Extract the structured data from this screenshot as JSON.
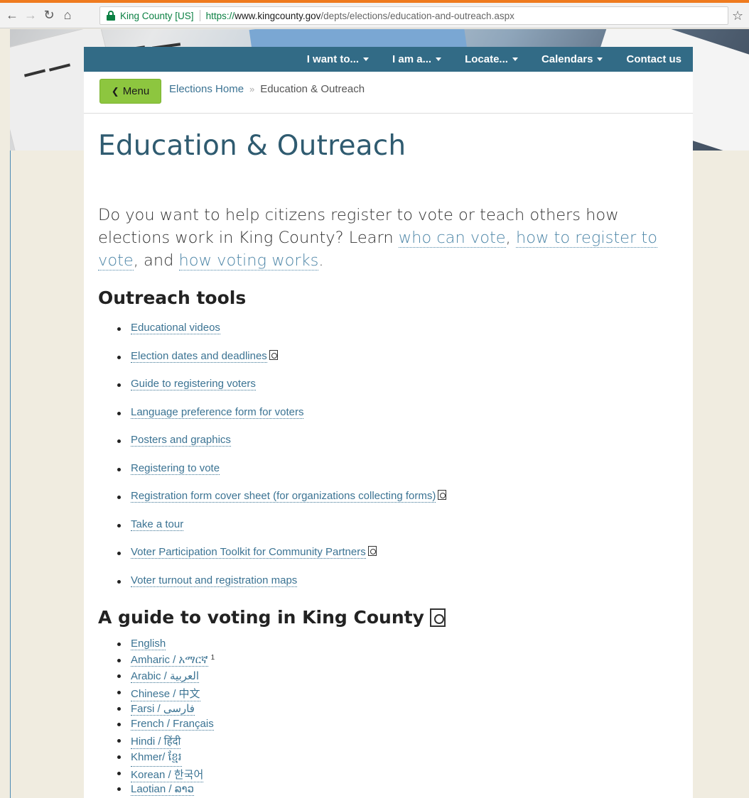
{
  "browser": {
    "cert_label": "King County [US]",
    "url_scheme": "https://",
    "url_host": "www.kingcounty.gov",
    "url_path": "/depts/elections/education-and-outreach.aspx",
    "icons": [
      "back-icon",
      "forward-icon",
      "reload-icon",
      "home-icon",
      "lock-icon",
      "star-icon"
    ]
  },
  "topnav": {
    "items": [
      {
        "label": "I want to..."
      },
      {
        "label": "I am a..."
      },
      {
        "label": "Locate..."
      },
      {
        "label": "Calendars"
      },
      {
        "label": "Contact us"
      }
    ]
  },
  "menu_button": {
    "label": "Menu"
  },
  "breadcrumb": {
    "home": "Elections Home",
    "current": "Education & Outreach",
    "separator": "»"
  },
  "page": {
    "title": "Education & Outreach",
    "intro": {
      "before": "Do you want to help citizens register to vote or teach others how elections work in King County? Learn ",
      "link1": "who can vote",
      "comma": ", ",
      "link2": "how to register to vote",
      "and": ", and ",
      "link3": "how voting works",
      "end": "."
    }
  },
  "outreach": {
    "heading": "Outreach tools",
    "items": [
      {
        "label": "Educational videos",
        "pdf": false
      },
      {
        "label": "Election dates and deadlines",
        "pdf": true
      },
      {
        "label": "Guide to registering voters",
        "pdf": false
      },
      {
        "label": "Language preference form for voters",
        "pdf": false
      },
      {
        "label": "Posters and graphics",
        "pdf": false
      },
      {
        "label": "Registering to vote",
        "pdf": false
      },
      {
        "label": "Registration form cover sheet (for organizations collecting forms)",
        "pdf": true
      },
      {
        "label": "Take a tour",
        "pdf": false
      },
      {
        "label": "Voter Participation Toolkit for Community Partners",
        "pdf": true
      },
      {
        "label": "Voter turnout and registration maps",
        "pdf": false
      }
    ]
  },
  "guide": {
    "heading": "A guide to voting in King County",
    "languages": [
      {
        "label": "English"
      },
      {
        "label": "Amharic / አማርኛ",
        "note": "1"
      },
      {
        "label": "Arabic / العربية"
      },
      {
        "label": "Chinese / 中文"
      },
      {
        "label": "Farsi / فارسی"
      },
      {
        "label": "French / Français"
      },
      {
        "label": "Hindi / हिंदी"
      },
      {
        "label": "Khmer/ ខ្មែរ"
      },
      {
        "label": "Korean / 한국어"
      },
      {
        "label": "Laotian / ລາວ"
      }
    ]
  },
  "colors": {
    "nav_bg": "#326b86",
    "menu_btn": "#8dc63f",
    "link": "#3b7393",
    "title": "#2f5b70",
    "page_bg": "#f0ece0"
  }
}
